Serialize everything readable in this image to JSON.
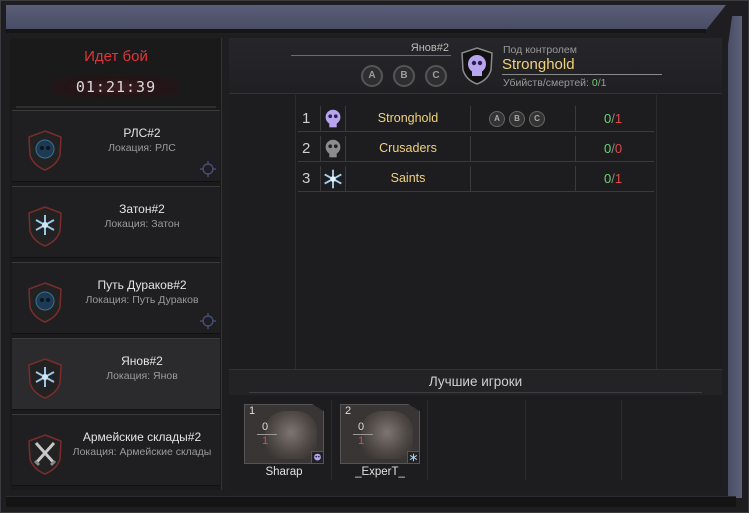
{
  "battle": {
    "status": "Идет бой",
    "timer": "01:21:39",
    "status_color": "#e0343a"
  },
  "locations": [
    {
      "name": "РЛС#2",
      "sub": "Локация: РЛС",
      "icon": "skull-emblem-icon",
      "selected": false,
      "has_target": true
    },
    {
      "name": "Затон#2",
      "sub": "Локация: Затон",
      "icon": "snowflake-emblem-icon",
      "selected": false,
      "has_target": false
    },
    {
      "name": "Путь Дураков#2",
      "sub": "Локация: Путь Дураков",
      "icon": "skull-emblem-icon",
      "selected": false,
      "has_target": true
    },
    {
      "name": "Янов#2",
      "sub": "Локация: Янов",
      "icon": "snowflake-emblem-icon",
      "selected": true,
      "has_target": false
    },
    {
      "name": "Армейские склады#2",
      "sub": "Локация: Армейские склады",
      "icon": "crossed-swords-emblem-icon",
      "selected": false,
      "has_target": false
    }
  ],
  "header": {
    "location": "Янов#2",
    "points": [
      "A",
      "B",
      "C"
    ],
    "controlled_label": "Под контролем",
    "controlled_by": "Stronghold",
    "kd_label": "Убийств/смертей:",
    "kills": "0",
    "deaths": "1"
  },
  "factions": [
    {
      "rank": "1",
      "name": "Stronghold",
      "icon": "skull-icon",
      "points": [
        "A",
        "B",
        "C"
      ],
      "kills": "0",
      "deaths": "1"
    },
    {
      "rank": "2",
      "name": "Crusaders",
      "icon": "grey-skull-icon",
      "points": [],
      "kills": "0",
      "deaths": "0"
    },
    {
      "rank": "3",
      "name": "Saints",
      "icon": "snowflake-icon",
      "points": [],
      "kills": "0",
      "deaths": "1"
    }
  ],
  "best_players": {
    "title": "Лучшие игроки",
    "players": [
      {
        "rank": "1",
        "name": "Sharap",
        "kills": "0",
        "deaths": "1",
        "faction_icon": "skull-icon"
      },
      {
        "rank": "2",
        "name": "_ExperT_",
        "kills": "0",
        "deaths": "1",
        "faction_icon": "snowflake-icon"
      }
    ]
  },
  "colors": {
    "accent_gold": "#f0d27c",
    "kill_green": "#6dd36d",
    "death_red": "#e24a4a",
    "frame_purple": "#5b5e78"
  }
}
